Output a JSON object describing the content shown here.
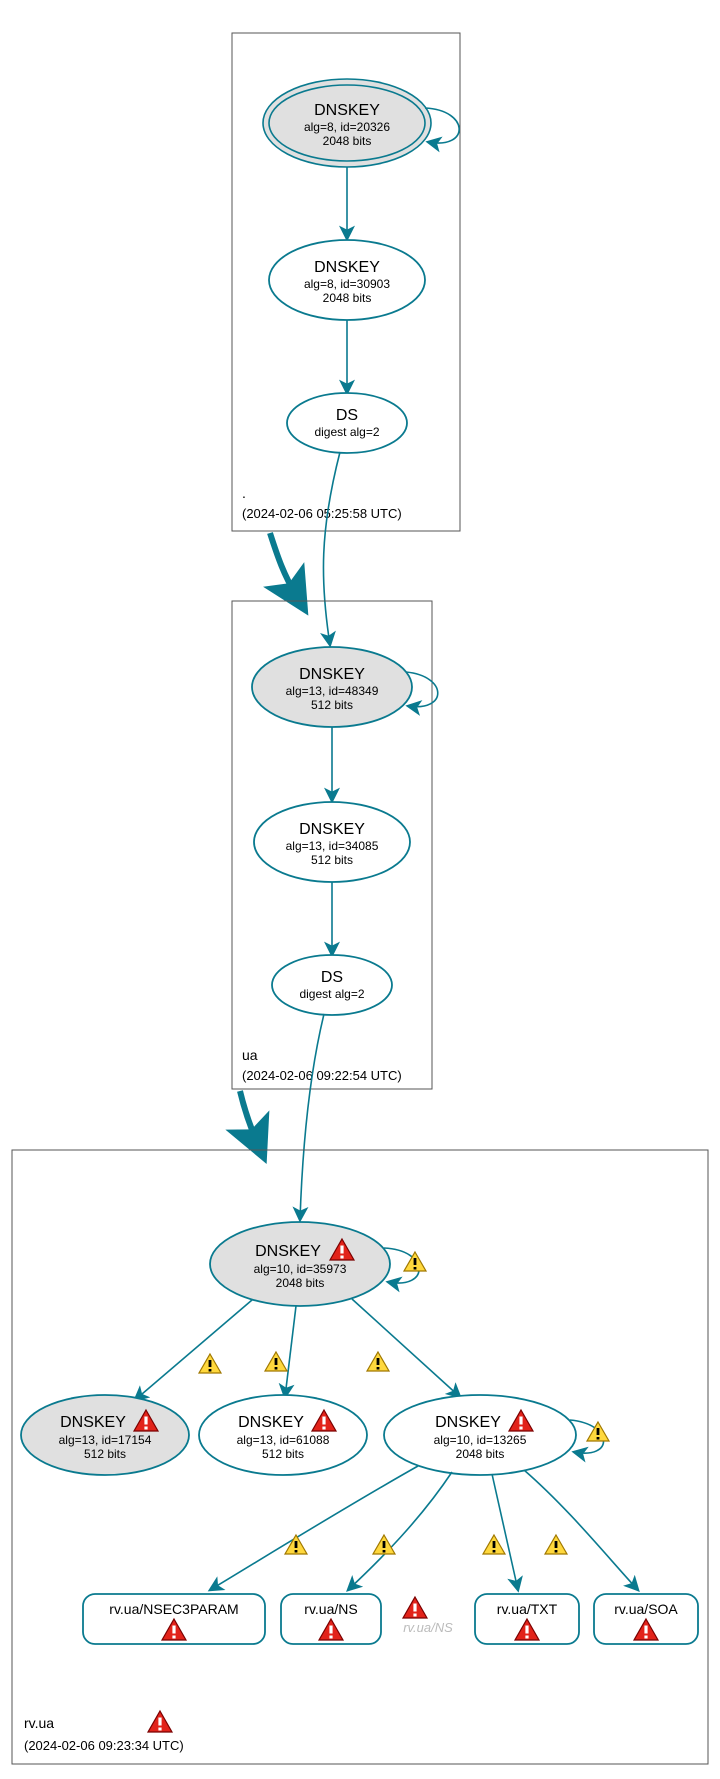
{
  "zones": {
    "root": {
      "label": ".",
      "timestamp": "(2024-02-06 05:25:58 UTC)"
    },
    "ua": {
      "label": "ua",
      "timestamp": "(2024-02-06 09:22:54 UTC)"
    },
    "rvua": {
      "label": "rv.ua",
      "timestamp": "(2024-02-06 09:23:34 UTC)"
    }
  },
  "nodes": {
    "root_ksk": {
      "title": "DNSKEY",
      "l2": "alg=8, id=20326",
      "l3": "2048 bits"
    },
    "root_zsk": {
      "title": "DNSKEY",
      "l2": "alg=8, id=30903",
      "l3": "2048 bits"
    },
    "root_ds": {
      "title": "DS",
      "l2": "digest alg=2"
    },
    "ua_ksk": {
      "title": "DNSKEY",
      "l2": "alg=13, id=48349",
      "l3": "512 bits"
    },
    "ua_zsk": {
      "title": "DNSKEY",
      "l2": "alg=13, id=34085",
      "l3": "512 bits"
    },
    "ua_ds": {
      "title": "DS",
      "l2": "digest alg=2"
    },
    "rv_ksk": {
      "title": "DNSKEY",
      "l2": "alg=10, id=35973",
      "l3": "2048 bits"
    },
    "rv_k1": {
      "title": "DNSKEY",
      "l2": "alg=13, id=17154",
      "l3": "512 bits"
    },
    "rv_k2": {
      "title": "DNSKEY",
      "l2": "alg=13, id=61088",
      "l3": "512 bits"
    },
    "rv_k3": {
      "title": "DNSKEY",
      "l2": "alg=10, id=13265",
      "l3": "2048 bits"
    }
  },
  "rrsets": {
    "nsec3param": "rv.ua/NSEC3PARAM",
    "ns": "rv.ua/NS",
    "txt": "rv.ua/TXT",
    "soa": "rv.ua/SOA"
  },
  "faded_ns": "rv.ua/NS",
  "chart_data": {
    "type": "graph",
    "description": "DNSSEC chain of trust from root (.) through ua to rv.ua, showing DNSKEY / DS records and signed RRsets with warning/error status icons.",
    "zones": [
      {
        "name": ".",
        "timestamp": "2024-02-06 05:25:58 UTC",
        "keys": [
          {
            "type": "DNSKEY",
            "role": "KSK",
            "alg": 8,
            "id": 20326,
            "bits": 2048,
            "self_signed": true,
            "warnings": false,
            "errors": false
          },
          {
            "type": "DNSKEY",
            "role": "ZSK",
            "alg": 8,
            "id": 30903,
            "bits": 2048,
            "warnings": false,
            "errors": false
          }
        ],
        "ds": [
          {
            "digest_alg": 2,
            "delegates_to": "ua"
          }
        ]
      },
      {
        "name": "ua",
        "timestamp": "2024-02-06 09:22:54 UTC",
        "keys": [
          {
            "type": "DNSKEY",
            "role": "KSK",
            "alg": 13,
            "id": 48349,
            "bits": 512,
            "self_signed": true,
            "warnings": false,
            "errors": false
          },
          {
            "type": "DNSKEY",
            "role": "ZSK",
            "alg": 13,
            "id": 34085,
            "bits": 512,
            "warnings": false,
            "errors": false
          }
        ],
        "ds": [
          {
            "digest_alg": 2,
            "delegates_to": "rv.ua"
          }
        ]
      },
      {
        "name": "rv.ua",
        "timestamp": "2024-02-06 09:23:34 UTC",
        "zone_errors": true,
        "keys": [
          {
            "type": "DNSKEY",
            "role": "KSK",
            "alg": 10,
            "id": 35973,
            "bits": 2048,
            "self_signed": true,
            "self_sign_warning": true,
            "errors": true
          },
          {
            "type": "DNSKEY",
            "alg": 13,
            "id": 17154,
            "bits": 512,
            "errors": true,
            "signed_by": 35973,
            "sign_warning": true,
            "grey": true
          },
          {
            "type": "DNSKEY",
            "alg": 13,
            "id": 61088,
            "bits": 512,
            "errors": true,
            "signed_by": 35973,
            "sign_warning": true
          },
          {
            "type": "DNSKEY",
            "alg": 10,
            "id": 13265,
            "bits": 2048,
            "errors": true,
            "signed_by": 35973,
            "sign_warning": true,
            "self_signed": true,
            "self_sign_warning": true
          }
        ],
        "rrsets": [
          {
            "name": "rv.ua/NSEC3PARAM",
            "signed_by": 13265,
            "sign_warning": true,
            "errors": true
          },
          {
            "name": "rv.ua/NS",
            "signed_by": 13265,
            "sign_warning": true,
            "errors": true
          },
          {
            "name": "rv.ua/TXT",
            "signed_by": 13265,
            "sign_warning": true,
            "errors": true
          },
          {
            "name": "rv.ua/SOA",
            "signed_by": 13265,
            "sign_warning": true,
            "errors": true
          }
        ],
        "unsigned_rrsets": [
          "rv.ua/NS"
        ]
      }
    ]
  }
}
